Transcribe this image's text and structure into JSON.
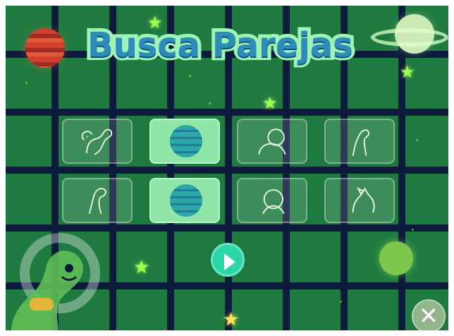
{
  "game": {
    "title": "Busca Parejas",
    "background_color": "#1f7a3f",
    "grid_color": "#0c1a3b",
    "accent_star": "#9cff4d"
  },
  "board": {
    "rows": [
      [
        {
          "state": "face-down",
          "icon": "pegasus-outline-icon"
        },
        {
          "state": "face-up",
          "icon": "striped-planet-icon"
        },
        {
          "state": "face-down",
          "icon": "lion-outline-icon"
        },
        {
          "state": "face-down",
          "icon": "llama-outline-icon"
        }
      ],
      [
        {
          "state": "face-down",
          "icon": "goose-outline-icon"
        },
        {
          "state": "face-up",
          "icon": "striped-planet-icon"
        },
        {
          "state": "face-down",
          "icon": "dodo-outline-icon"
        },
        {
          "state": "face-down",
          "icon": "fox-outline-icon"
        }
      ]
    ]
  },
  "controls": {
    "play_icon": "play-icon",
    "close_icon": "close-icon",
    "close_glyph": "✕"
  },
  "decor": {
    "star_glyph": "★",
    "planets": [
      "red-planet-icon",
      "ringed-planet-icon",
      "green-planet-icon"
    ],
    "mascot": "dino-mascot-icon"
  }
}
